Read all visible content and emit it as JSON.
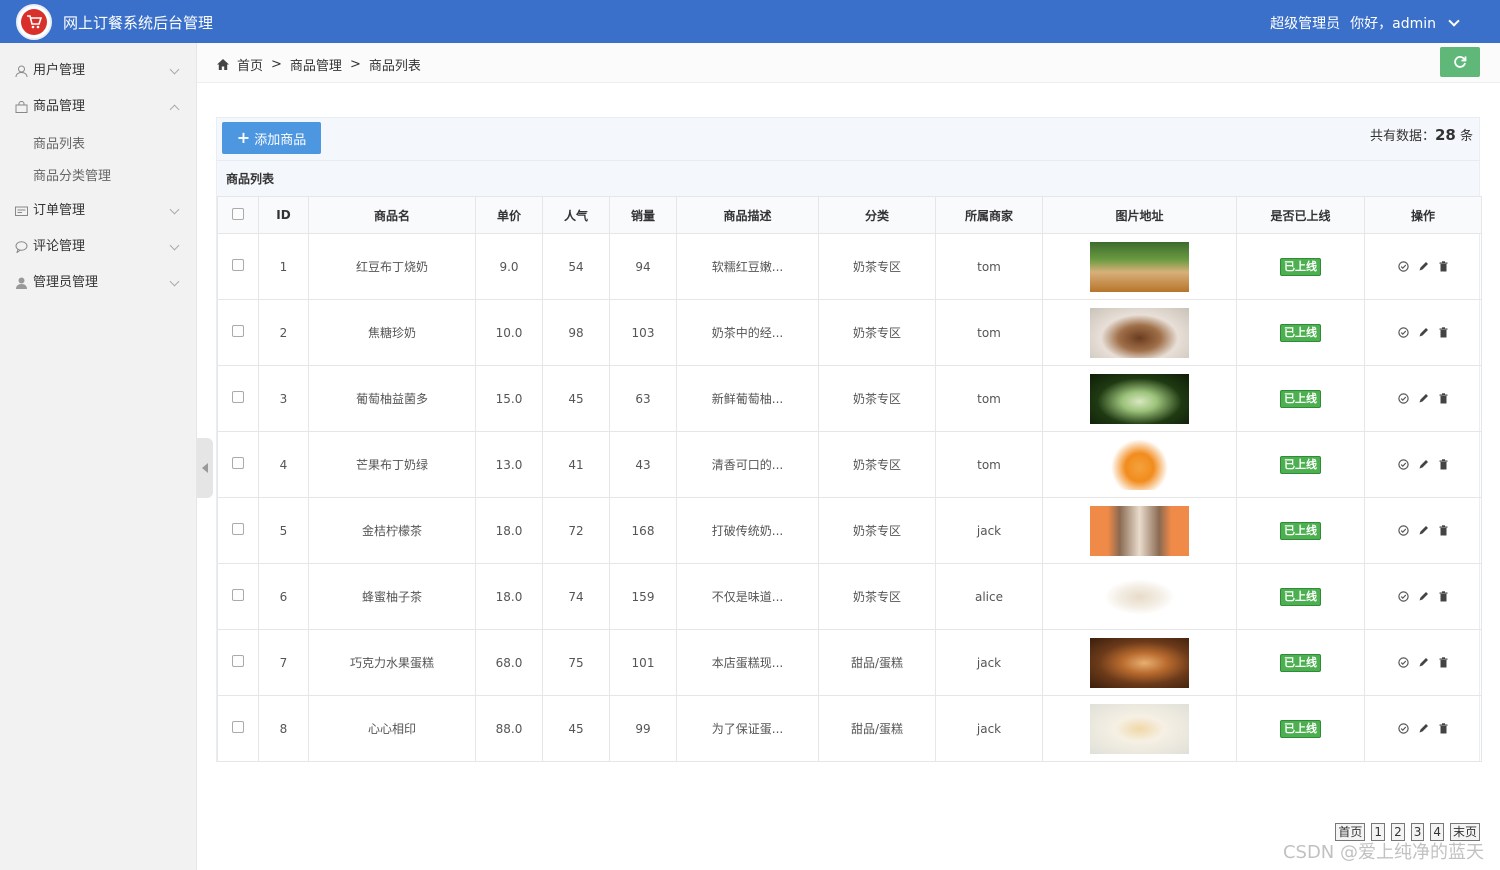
{
  "header": {
    "app_title": "网上订餐系统后台管理",
    "role": "超级管理员",
    "greeting": "你好，admin"
  },
  "sidebar": {
    "items": [
      {
        "label": "用户管理",
        "icon": "user-icon",
        "expanded": false
      },
      {
        "label": "商品管理",
        "icon": "bag-icon",
        "expanded": true,
        "children": [
          {
            "label": "商品列表"
          },
          {
            "label": "商品分类管理"
          }
        ]
      },
      {
        "label": "订单管理",
        "icon": "order-icon",
        "expanded": false
      },
      {
        "label": "评论管理",
        "icon": "comment-icon",
        "expanded": false
      },
      {
        "label": "管理员管理",
        "icon": "admin-icon",
        "expanded": false
      }
    ]
  },
  "breadcrumb": {
    "home": "首页",
    "sep": ">",
    "level1": "商品管理",
    "level2": "商品列表"
  },
  "toolbar": {
    "add_label": "添加商品",
    "total_prefix": "共有数据：",
    "total_count": "28",
    "total_suffix": " 条"
  },
  "list_title": "商品列表",
  "table": {
    "headers": [
      "ID",
      "商品名",
      "单价",
      "人气",
      "销量",
      "商品描述",
      "分类",
      "所属商家",
      "图片地址",
      "是否已上线",
      "操作"
    ],
    "rows": [
      {
        "id": "1",
        "name": "红豆布丁烧奶",
        "price": "9.0",
        "popularity": "54",
        "sales": "94",
        "desc": "软糯红豆嫩...",
        "category": "奶茶专区",
        "merchant": "tom",
        "status": "已上线",
        "image": "milk-tea-cup-photo"
      },
      {
        "id": "2",
        "name": "焦糖珍奶",
        "price": "10.0",
        "popularity": "98",
        "sales": "103",
        "desc": "奶茶中的经...",
        "category": "奶茶专区",
        "merchant": "tom",
        "status": "已上线",
        "image": "caramel-milk-photo"
      },
      {
        "id": "3",
        "name": "葡萄柚益菌多",
        "price": "15.0",
        "popularity": "45",
        "sales": "63",
        "desc": "新鲜葡萄柚...",
        "category": "奶茶专区",
        "merchant": "tom",
        "status": "已上线",
        "image": "green-drink-photo"
      },
      {
        "id": "4",
        "name": "芒果布丁奶绿",
        "price": "13.0",
        "popularity": "41",
        "sales": "43",
        "desc": "清香可口的...",
        "category": "奶茶专区",
        "merchant": "tom",
        "status": "已上线",
        "image": "orange-cup-photo"
      },
      {
        "id": "5",
        "name": "金桔柠檬茶",
        "price": "18.0",
        "popularity": "72",
        "sales": "168",
        "desc": "打破传统奶...",
        "category": "奶茶专区",
        "merchant": "jack",
        "status": "已上线",
        "image": "tea-window-photo"
      },
      {
        "id": "6",
        "name": "蜂蜜柚子茶",
        "price": "18.0",
        "popularity": "74",
        "sales": "159",
        "desc": "不仅是味道...",
        "category": "奶茶专区",
        "merchant": "alice",
        "status": "已上线",
        "image": "glass-cup-photo"
      },
      {
        "id": "7",
        "name": "巧克力水果蛋糕",
        "price": "68.0",
        "popularity": "75",
        "sales": "101",
        "desc": "本店蛋糕现...",
        "category": "甜品/蛋糕",
        "merchant": "jack",
        "status": "已上线",
        "image": "tart-photo"
      },
      {
        "id": "8",
        "name": "心心相印",
        "price": "88.0",
        "popularity": "45",
        "sales": "99",
        "desc": "为了保证蛋...",
        "category": "甜品/蛋糕",
        "merchant": "jack",
        "status": "已上线",
        "image": "dessert-plate-photo"
      }
    ]
  },
  "pagination": {
    "first": "首页",
    "pages": [
      "1",
      "2",
      "3",
      "4"
    ],
    "last": "末页"
  },
  "watermark": "CSDN @爱上纯净的蓝天",
  "colors": {
    "header_bg": "#3a70c9",
    "add_button": "#4d96e0",
    "refresh_button": "#5fb878",
    "badge_green": "#4caf50"
  }
}
